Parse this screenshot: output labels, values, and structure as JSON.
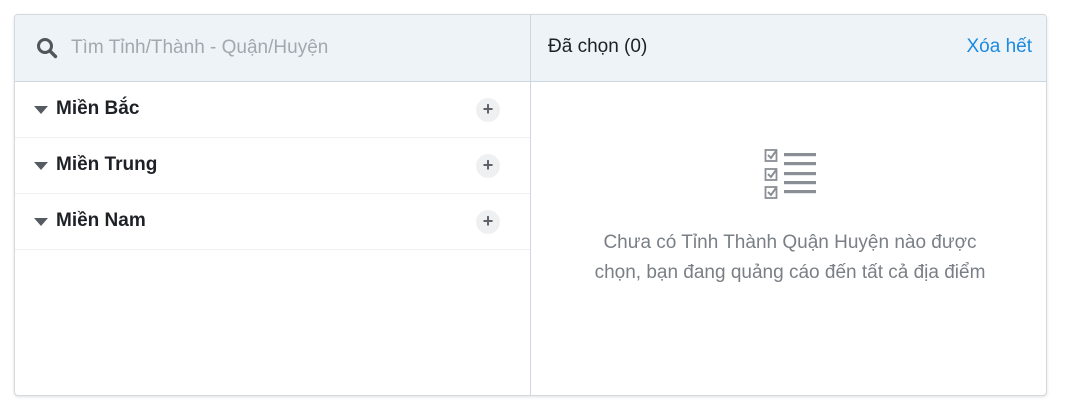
{
  "search": {
    "placeholder": "Tìm Tỉnh/Thành - Quận/Huyện",
    "value": ""
  },
  "selected": {
    "title": "Đã chọn (0)",
    "clear_all_label": "Xóa hết"
  },
  "regions": [
    {
      "label": "Miền Bắc",
      "add_label": "+"
    },
    {
      "label": "Miền Trung",
      "add_label": "+"
    },
    {
      "label": "Miền Nam",
      "add_label": "+"
    }
  ],
  "empty_state": {
    "icon": "checklist-icon",
    "message": "Chưa có Tỉnh Thành Quận Huyện nào được chọn, bạn đang quảng cáo đến tất cả địa điểm"
  },
  "colors": {
    "accent": "#1a8be0",
    "header_bg": "#eef3f8",
    "border": "#cfd7de",
    "text_muted": "#7a7f85"
  }
}
